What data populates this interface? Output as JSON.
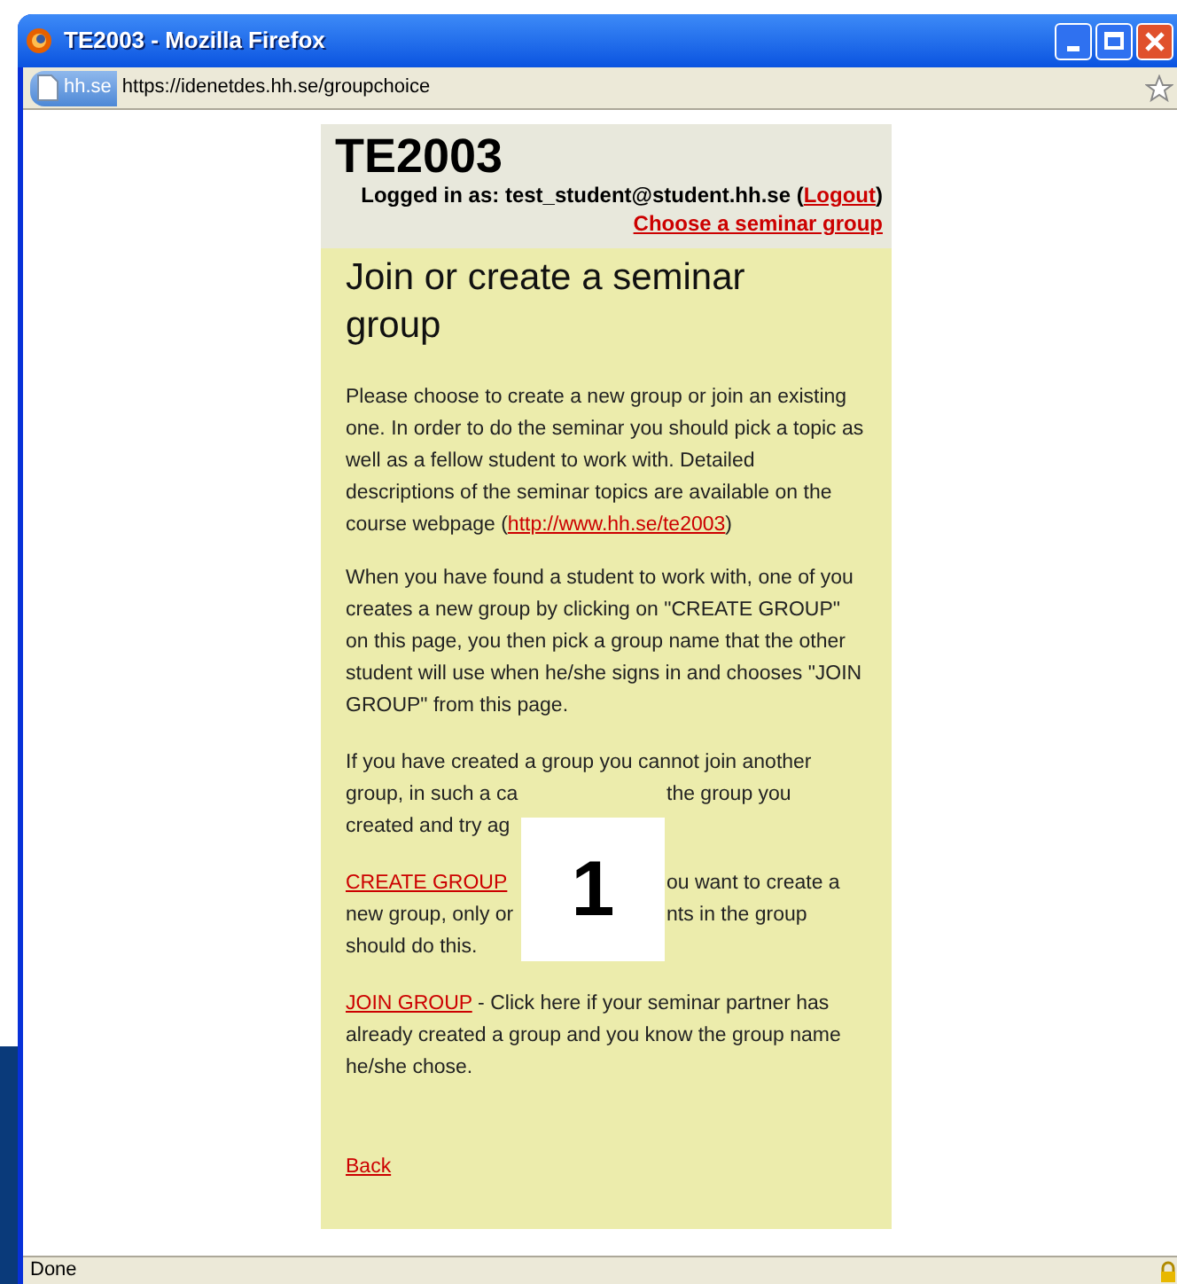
{
  "window": {
    "title": "TE2003 - Mozilla Firefox"
  },
  "address_bar": {
    "site_label": "hh.se",
    "url": "https://idenetdes.hh.se/groupchoice"
  },
  "page": {
    "course_title": "TE2003",
    "login": {
      "prefix": "Logged in as: test_student@student.hh.se (",
      "link": "Logout",
      "suffix": ")"
    },
    "nav_link": "Choose a seminar group",
    "heading": "Join or create a seminar group",
    "intro": {
      "text": "Please choose to create a new group or join an existing one. In order to do the seminar you should pick a topic as well as a fellow student to work with. Detailed descriptions of the seminar topics are available on the course webpage (",
      "link": "http://www.hh.se/te2003",
      "suffix": ")"
    },
    "how_to": "When you have found a student to work with, one of you creates a new group by clicking on \"CREATE GROUP\" on this page, you then pick a group name that the other student will use when he/she signs in and chooses \"JOIN GROUP\" from this page.",
    "covered_paragraphs": [
      {
        "lines": [
          {
            "left": "If you have created a group you cannot join another"
          },
          {
            "left": "group, in such a ca",
            "right": "the group you"
          },
          {
            "left": "created and try ag"
          }
        ]
      },
      {
        "lines": [
          {
            "link": "CREATE GROUP",
            "right": "ou want to create a"
          },
          {
            "left": "new group, only or",
            "right": "nts in the group"
          },
          {
            "left": "should do this."
          }
        ]
      }
    ],
    "join": {
      "link": "JOIN GROUP",
      "text": " - Click here if your seminar partner has already created a group and you know the group name he/she chose."
    },
    "back_link": "Back"
  },
  "overlay": {
    "label": "1"
  },
  "status_bar": {
    "text": "Done"
  }
}
